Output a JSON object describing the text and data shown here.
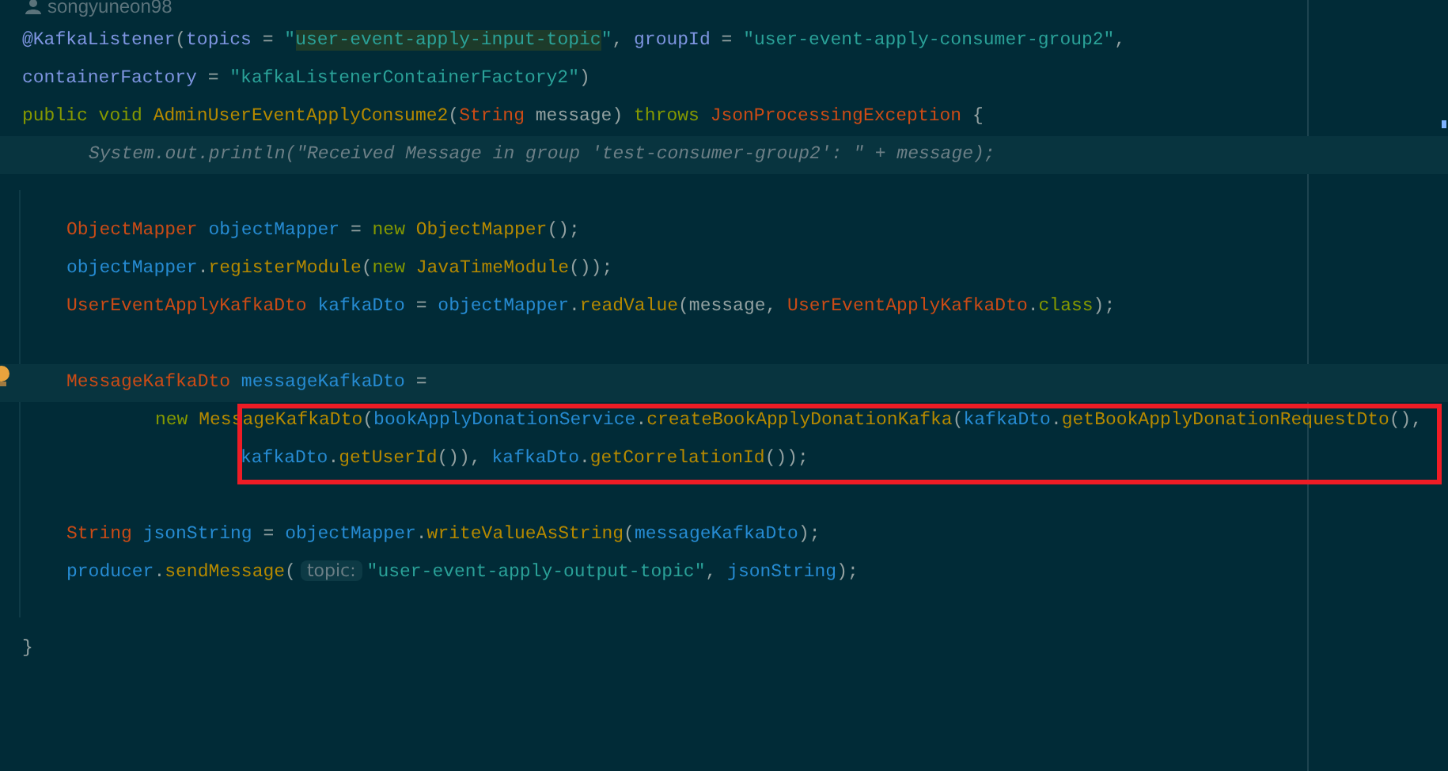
{
  "author_hint": "songyuneon98",
  "lines": [
    {
      "kind": "top",
      "highlighted": false,
      "tokens": [
        {
          "kind": "annotation",
          "text": "@KafkaListener"
        },
        {
          "kind": "plain",
          "text": "("
        },
        {
          "kind": "annotation",
          "text": "topics"
        },
        {
          "kind": "plain",
          "text": " = "
        },
        {
          "kind": "string",
          "text": "\""
        },
        {
          "kind": "match",
          "text": "user-event-apply-input-topic"
        },
        {
          "kind": "string",
          "text": "\""
        },
        {
          "kind": "plain",
          "text": ", "
        },
        {
          "kind": "annotation",
          "text": "groupId"
        },
        {
          "kind": "plain",
          "text": " = "
        },
        {
          "kind": "string",
          "text": "\"user-event-apply-consumer-group2\""
        },
        {
          "kind": "plain",
          "text": ","
        }
      ]
    },
    {
      "kind": "top",
      "highlighted": false,
      "tokens": [
        {
          "kind": "annotation",
          "text": "containerFactory"
        },
        {
          "kind": "plain",
          "text": " = "
        },
        {
          "kind": "string",
          "text": "\"kafkaListenerContainerFactory2\""
        },
        {
          "kind": "plain",
          "text": ")"
        }
      ]
    },
    {
      "kind": "top",
      "highlighted": false,
      "tokens": [
        {
          "kind": "keyword",
          "text": "public void "
        },
        {
          "kind": "method",
          "text": "AdminUserEventApplyConsume2"
        },
        {
          "kind": "plain",
          "text": "("
        },
        {
          "kind": "type",
          "text": "String"
        },
        {
          "kind": "plain",
          "text": " message) "
        },
        {
          "kind": "keyword",
          "text": "throws "
        },
        {
          "kind": "type",
          "text": "JsonProcessingException"
        },
        {
          "kind": "plain",
          "text": " {"
        }
      ]
    },
    {
      "kind": "folded",
      "highlighted": true,
      "tokens": [
        {
          "kind": "comment",
          "text": "System.out.println(\"Received Message in group 'test-consumer-group2': \" + message);"
        }
      ]
    },
    {
      "highlighted": false
    },
    {
      "kind": "body",
      "highlighted": false,
      "tokens": [
        {
          "kind": "type",
          "text": "ObjectMapper"
        },
        {
          "kind": "var",
          "text": " objectMapper"
        },
        {
          "kind": "plain",
          "text": " = "
        },
        {
          "kind": "keyword",
          "text": "new "
        },
        {
          "kind": "method",
          "text": "ObjectMapper"
        },
        {
          "kind": "plain",
          "text": "();"
        }
      ]
    },
    {
      "kind": "body",
      "highlighted": false,
      "tokens": [
        {
          "kind": "var",
          "text": "objectMapper"
        },
        {
          "kind": "plain",
          "text": "."
        },
        {
          "kind": "method",
          "text": "registerModule"
        },
        {
          "kind": "plain",
          "text": "("
        },
        {
          "kind": "keyword",
          "text": "new "
        },
        {
          "kind": "method",
          "text": "JavaTimeModule"
        },
        {
          "kind": "plain",
          "text": "());"
        }
      ]
    },
    {
      "kind": "body",
      "highlighted": false,
      "tokens": [
        {
          "kind": "type",
          "text": "UserEventApplyKafkaDto"
        },
        {
          "kind": "var",
          "text": " kafkaDto"
        },
        {
          "kind": "plain",
          "text": " = "
        },
        {
          "kind": "var",
          "text": "objectMapper"
        },
        {
          "kind": "plain",
          "text": "."
        },
        {
          "kind": "method",
          "text": "readValue"
        },
        {
          "kind": "plain",
          "text": "(message, "
        },
        {
          "kind": "type",
          "text": "UserEventApplyKafkaDto"
        },
        {
          "kind": "plain",
          "text": "."
        },
        {
          "kind": "keyword",
          "text": "class"
        },
        {
          "kind": "plain",
          "text": ");"
        }
      ]
    },
    {
      "highlighted": false
    },
    {
      "kind": "body",
      "highlighted": true,
      "tokens": [
        {
          "kind": "type",
          "text": "MessageKafkaDto"
        },
        {
          "kind": "var",
          "text": " messageKafkaDto"
        },
        {
          "kind": "plain",
          "text": " ="
        }
      ]
    },
    {
      "kind": "continuation",
      "highlighted": false,
      "tokens": [
        {
          "kind": "keyword",
          "text": "new "
        },
        {
          "kind": "method",
          "text": "MessageKafkaDto"
        },
        {
          "kind": "plain",
          "text": "("
        },
        {
          "kind": "var",
          "text": "bookApplyDonationService"
        },
        {
          "kind": "plain",
          "text": "."
        },
        {
          "kind": "method",
          "text": "createBookApplyDonationKafka"
        },
        {
          "kind": "plain",
          "text": "("
        },
        {
          "kind": "var",
          "text": "kafkaDto"
        },
        {
          "kind": "plain",
          "text": "."
        },
        {
          "kind": "method",
          "text": "getBookApplyDonationRequestDto"
        },
        {
          "kind": "plain",
          "text": "(),"
        }
      ]
    },
    {
      "kind": "argument",
      "highlighted": false,
      "tokens": [
        {
          "kind": "var",
          "text": "kafkaDto"
        },
        {
          "kind": "plain",
          "text": "."
        },
        {
          "kind": "method",
          "text": "getUserId"
        },
        {
          "kind": "plain",
          "text": "()), "
        },
        {
          "kind": "var",
          "text": "kafkaDto"
        },
        {
          "kind": "plain",
          "text": "."
        },
        {
          "kind": "method",
          "text": "getCorrelationId"
        },
        {
          "kind": "plain",
          "text": "());"
        }
      ]
    },
    {
      "highlighted": false
    },
    {
      "kind": "body",
      "highlighted": false,
      "tokens": [
        {
          "kind": "type",
          "text": "String"
        },
        {
          "kind": "var",
          "text": " jsonString"
        },
        {
          "kind": "plain",
          "text": " = "
        },
        {
          "kind": "var",
          "text": "objectMapper"
        },
        {
          "kind": "plain",
          "text": "."
        },
        {
          "kind": "method",
          "text": "writeValueAsString"
        },
        {
          "kind": "plain",
          "text": "("
        },
        {
          "kind": "var",
          "text": "messageKafkaDto"
        },
        {
          "kind": "plain",
          "text": ");"
        }
      ]
    },
    {
      "kind": "body",
      "highlighted": false,
      "tokens": [
        {
          "kind": "var",
          "text": "producer"
        },
        {
          "kind": "plain",
          "text": "."
        },
        {
          "kind": "method",
          "text": "sendMessage"
        },
        {
          "kind": "plain",
          "text": "("
        },
        {
          "kind": "hint",
          "text": "topic:"
        },
        {
          "kind": "string",
          "text": "\"user-event-apply-output-topic\""
        },
        {
          "kind": "plain",
          "text": ", "
        },
        {
          "kind": "var",
          "text": "jsonString"
        },
        {
          "kind": "plain",
          "text": ");"
        }
      ]
    },
    {
      "highlighted": false
    },
    {
      "kind": "top",
      "highlighted": false,
      "tokens": [
        {
          "kind": "plain",
          "text": "}"
        }
      ]
    }
  ]
}
